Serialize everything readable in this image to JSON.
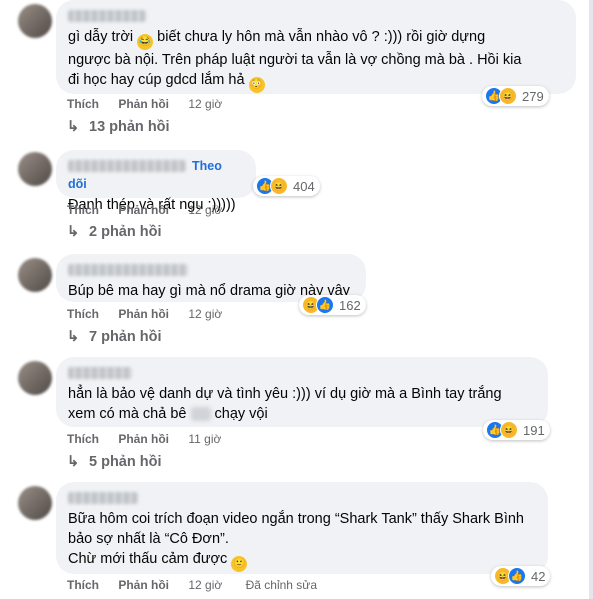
{
  "comments": [
    {
      "line1_a": "gì dẫy trời ",
      "line1_b": " biết chưa ly hôn mà vẫn nhào vô ? :))) rồi giờ dựng",
      "line2": "ngược bà nội. Trên pháp luật người ta vẫn là vợ chồng mà bà . Hồi kia",
      "line3": "đi học hay cúp gdcd lắm hả ",
      "like": "Thích",
      "reply": "Phản hồi",
      "time": "12 giờ",
      "reaction_count": "279",
      "replies": "13 phản hồi"
    },
    {
      "follow": "Theo dõi",
      "text": "Đanh thép và rất ngu :)))))",
      "like": "Thích",
      "reply": "Phản hồi",
      "time": "12 giờ",
      "reaction_count": "404",
      "replies": "2 phản hồi"
    },
    {
      "text": "Búp bê ma hay gì mà nổ drama giờ này vậy",
      "like": "Thích",
      "reply": "Phản hồi",
      "time": "12 giờ",
      "reaction_count": "162",
      "replies": "7 phản hồi"
    },
    {
      "line1": "hẳn là bảo vệ danh dự và tình yêu :))) ví dụ giờ mà a Bình tay trắng",
      "line2_a": "xem có mà chả bê ",
      "line2_b": " chạy vội",
      "like": "Thích",
      "reply": "Phản hồi",
      "time": "11 giờ",
      "reaction_count": "191",
      "replies": "5 phản hồi"
    },
    {
      "line1": "Bữa hôm coi trích đoạn video ngắn trong “Shark Tank” thấy Shark Bình",
      "line2": "bảo sợ nhất là “Cô Đơn”.",
      "line3": "Chừ mới thấu cảm được ",
      "like": "Thích",
      "reply": "Phản hồi",
      "time": "12 giờ",
      "edited": "Đã chỉnh sửa",
      "reaction_count": "42"
    }
  ],
  "icons": {
    "like": "like-icon",
    "haha": "haha-icon",
    "reply_arrow": "reply-arrow-icon"
  },
  "colors": {
    "bubble": "#f0f2f5",
    "link": "#216fdb",
    "meta": "#65676b",
    "like": "#1877f2",
    "haha": "#f7b928"
  }
}
